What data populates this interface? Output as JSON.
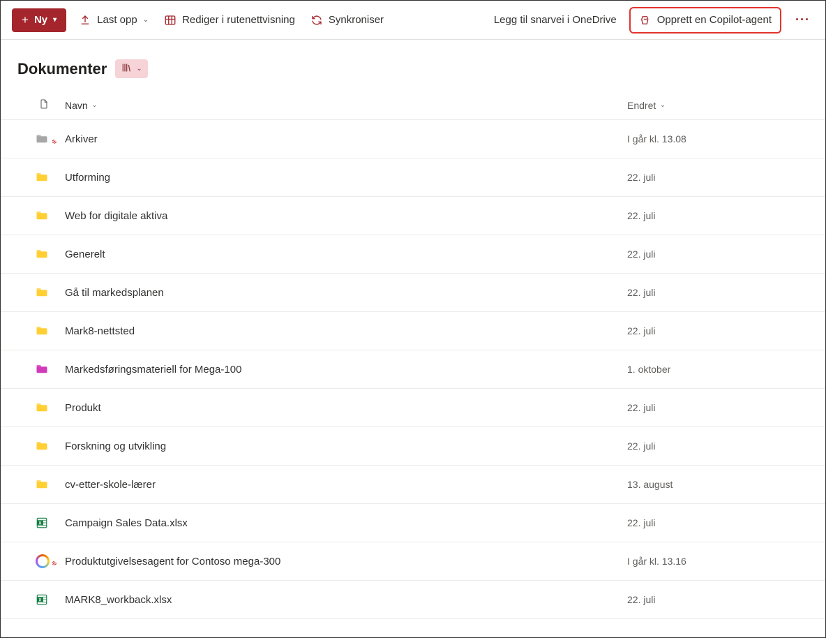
{
  "toolbar": {
    "new_label": "Ny",
    "upload_label": "Last opp",
    "edit_grid_label": "Rediger i rutenettvisning",
    "sync_label": "Synkroniser",
    "shortcut_label": "Legg til snarvei i OneDrive",
    "copilot_label": "Opprett en Copilot-agent"
  },
  "page": {
    "title": "Dokumenter"
  },
  "columns": {
    "name": "Navn",
    "modified": "Endret"
  },
  "items": [
    {
      "icon": "folder-gray",
      "name": "Arkiver",
      "modified": "I går kl. 13.08",
      "newmark": true
    },
    {
      "icon": "folder",
      "name": "Utforming",
      "modified": "22. juli"
    },
    {
      "icon": "folder",
      "name": "Web for digitale aktiva",
      "modified": "22. juli"
    },
    {
      "icon": "folder",
      "name": "Generelt",
      "modified": "22. juli"
    },
    {
      "icon": "folder",
      "name": "Gå til markedsplanen",
      "modified": "22. juli"
    },
    {
      "icon": "folder",
      "name": "Mark8-nettsted",
      "modified": "22. juli"
    },
    {
      "icon": "folder-magenta",
      "name": "Markedsføringsmateriell for Mega-100",
      "modified": "1. oktober"
    },
    {
      "icon": "folder",
      "name": "Produkt",
      "modified": "22. juli"
    },
    {
      "icon": "folder",
      "name": "Forskning og utvikling",
      "modified": "22. juli"
    },
    {
      "icon": "folder",
      "name": "cv-etter-skole-lærer",
      "modified": "13. august"
    },
    {
      "icon": "excel",
      "name": "Campaign Sales Data.xlsx",
      "modified": "22. juli"
    },
    {
      "icon": "copilot",
      "name": "Produktutgivelsesagent for Contoso mega-300",
      "modified": "I går kl. 13.16",
      "newmark": true
    },
    {
      "icon": "excel",
      "name": "MARK8_workback.xlsx",
      "modified": "22. juli"
    }
  ]
}
